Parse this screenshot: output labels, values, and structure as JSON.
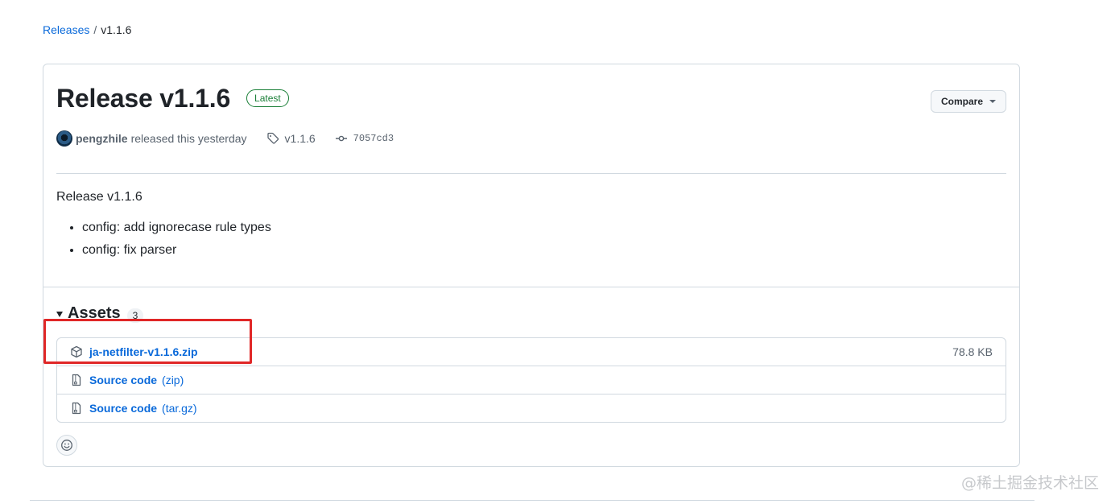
{
  "breadcrumb": {
    "root": "Releases",
    "separator": "/",
    "current": "v1.1.6"
  },
  "release": {
    "title": "Release v1.1.6",
    "badge": "Latest",
    "author": "pengzhile",
    "released_text": "released this yesterday",
    "tag": "v1.1.6",
    "commit": "7057cd3",
    "compare_label": "Compare"
  },
  "notes": {
    "heading": "Release v1.1.6",
    "items": [
      "config: add ignorecase rule types",
      "config: fix parser"
    ]
  },
  "assets": {
    "title": "Assets",
    "count": "3",
    "items": [
      {
        "name": "ja-netfilter-v1.1.6.zip",
        "ext": "",
        "size": "78.8 KB",
        "icon": "package-icon"
      },
      {
        "name": "Source code",
        "ext": "(zip)",
        "size": "",
        "icon": "file-zip-icon"
      },
      {
        "name": "Source code",
        "ext": "(tar.gz)",
        "size": "",
        "icon": "file-zip-icon"
      }
    ]
  },
  "watermark": "@稀土掘金技术社区",
  "colors": {
    "accent": "#0969da",
    "latest": "#1a7f37",
    "highlight": "#e02727"
  }
}
